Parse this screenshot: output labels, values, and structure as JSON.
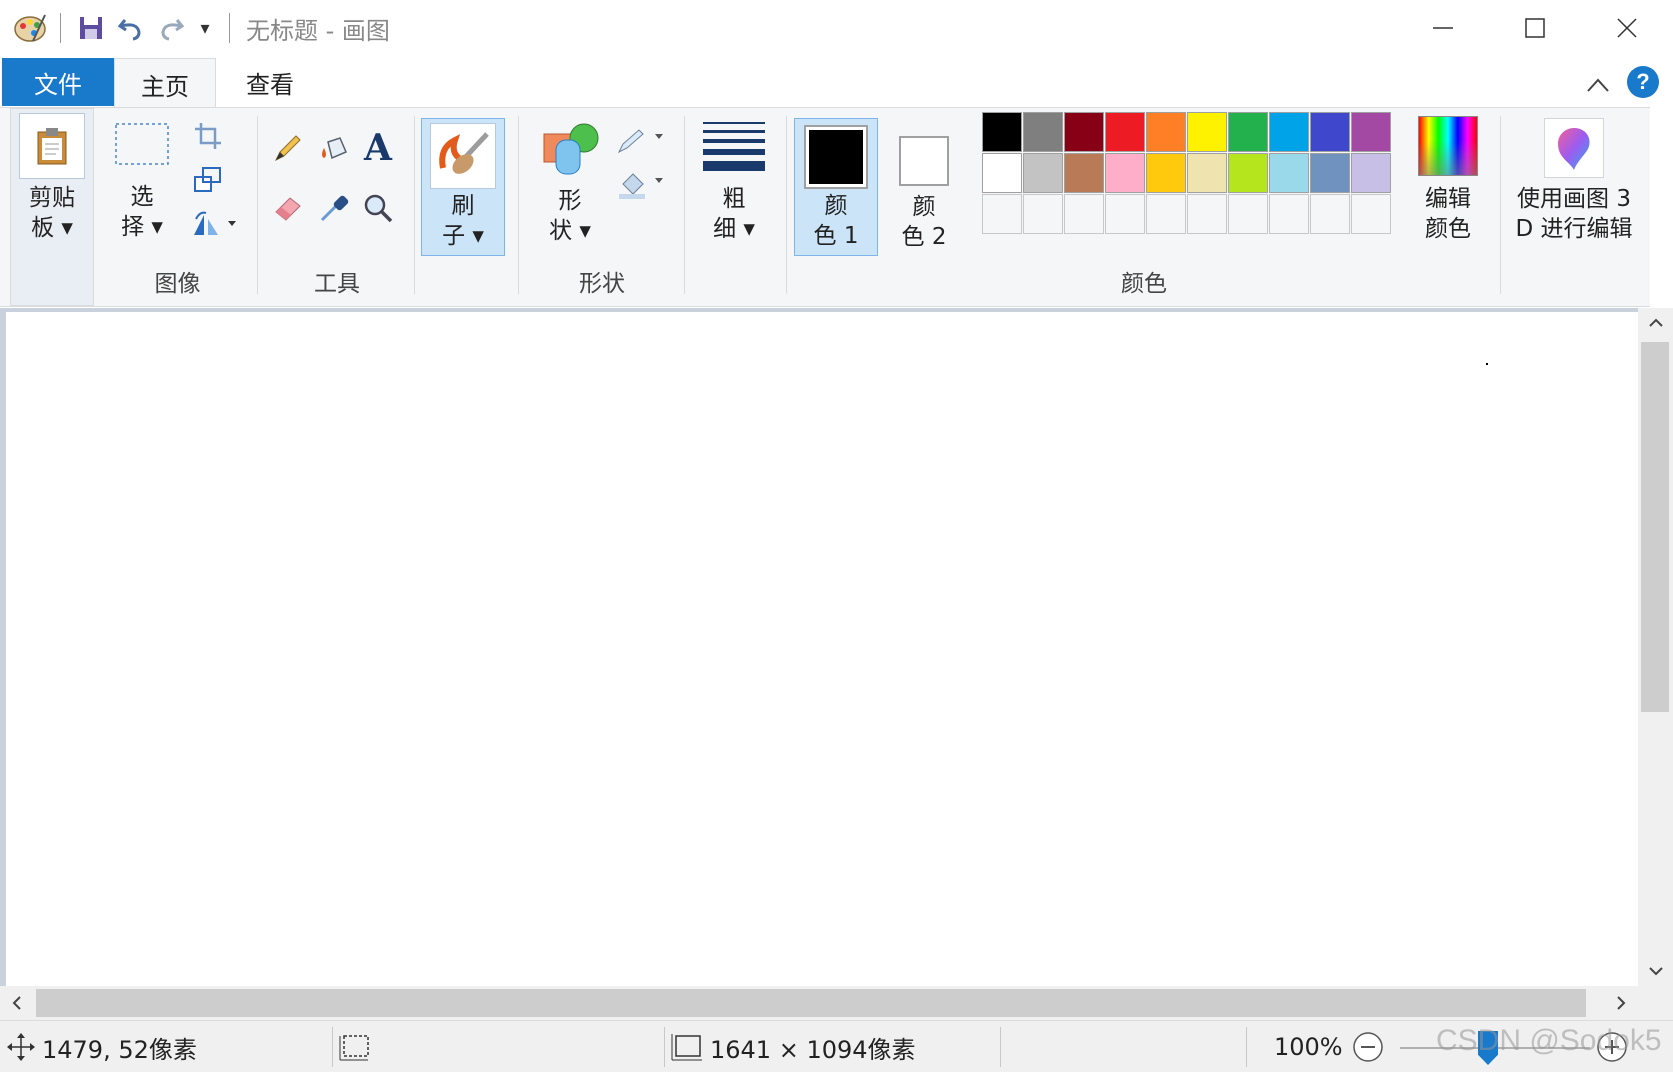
{
  "window": {
    "title": "无标题 - 画图",
    "qat_customize": "▾"
  },
  "tabs": [
    {
      "label": "文件"
    },
    {
      "label": "主页"
    },
    {
      "label": "查看"
    }
  ],
  "help_label": "?",
  "ribbon": {
    "clipboard": {
      "label": "剪贴\n板 ▾"
    },
    "image": {
      "group_label": "图像",
      "select_label": "选\n择 ▾"
    },
    "tools": {
      "group_label": "工具",
      "text_glyph": "A"
    },
    "brushes": {
      "label": "刷\n子 ▾"
    },
    "shapes": {
      "group_label": "形状",
      "label": "形\n状 ▾"
    },
    "size": {
      "label": "粗\n细 ▾"
    },
    "colors": {
      "group_label": "颜色",
      "color1_label": "颜\n色 1",
      "color2_label": "颜\n色 2",
      "color1": "#000000",
      "color2": "#ffffff",
      "edit_label": "编辑\n颜色",
      "palette_row1": [
        "#000000",
        "#7f7f7f",
        "#880015",
        "#ed1c24",
        "#ff7f27",
        "#fff200",
        "#22b14c",
        "#00a2e8",
        "#3f48cc",
        "#a349a4"
      ],
      "palette_row2": [
        "#ffffff",
        "#c3c3c3",
        "#b97a57",
        "#ffaec9",
        "#ffc90e",
        "#efe4b0",
        "#b5e61d",
        "#99d9ea",
        "#7092be",
        "#c8bfe7"
      ]
    },
    "paint3d": {
      "label": "使用画图 3\nD 进行编辑"
    }
  },
  "status": {
    "cursor_pos": "1479, 52像素",
    "canvas_size": "1641 × 1094像素",
    "zoom": "100%"
  },
  "watermark": "CSDN @Sodok5"
}
